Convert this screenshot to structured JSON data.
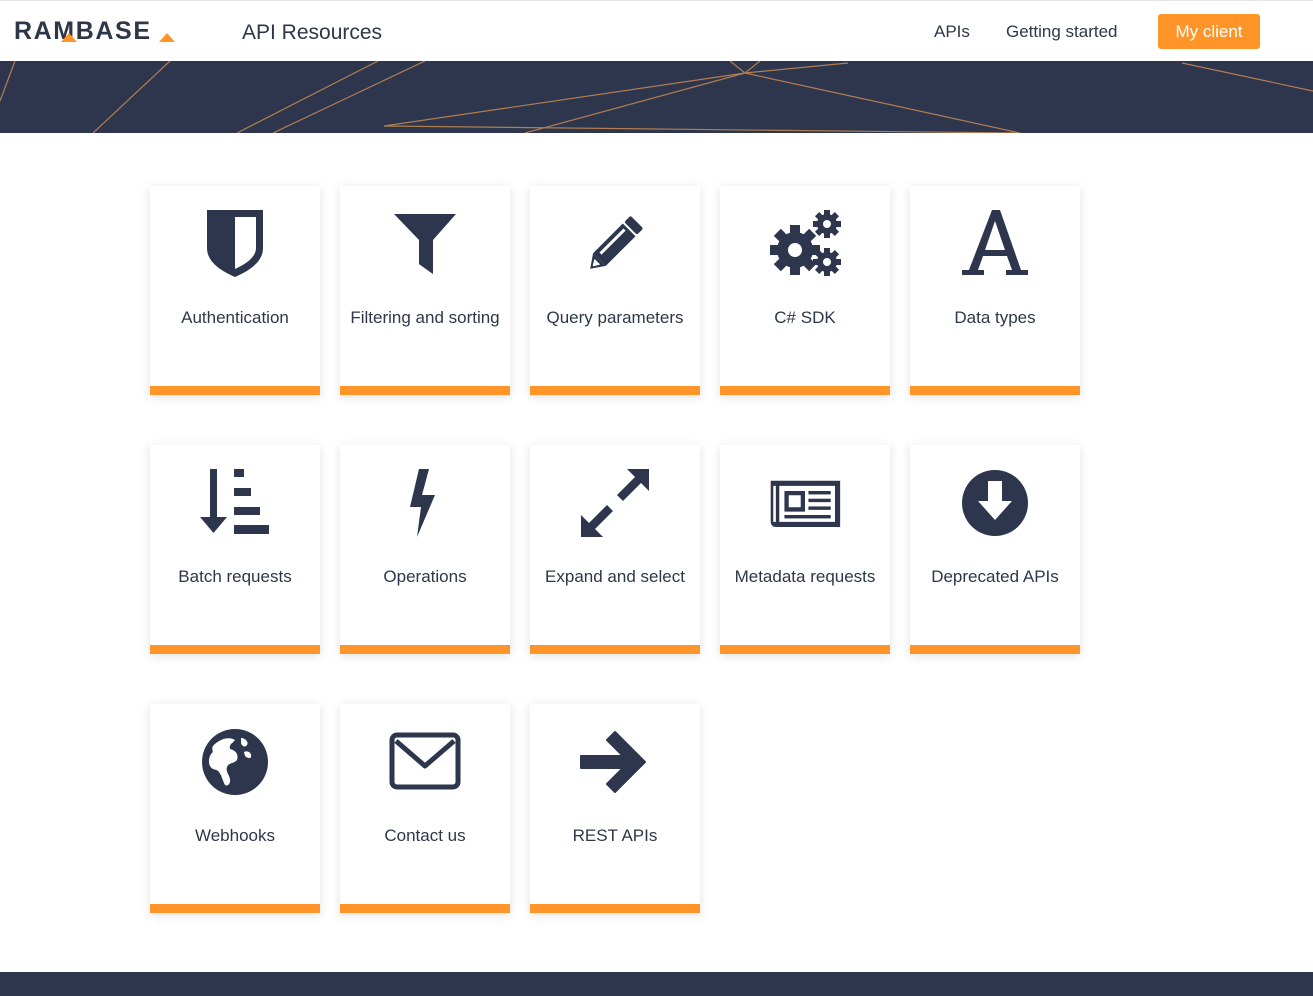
{
  "header": {
    "logo": "RAMBASE",
    "title": "API Resources",
    "nav": [
      {
        "label": "APIs"
      },
      {
        "label": "Getting started"
      }
    ],
    "cta_label": "My client"
  },
  "colors": {
    "accent": "#ff9428",
    "navy": "#2d364c",
    "text": "#2d3748"
  },
  "cards": [
    {
      "label": "Authentication",
      "icon": "shield-icon"
    },
    {
      "label": "Filtering and sorting",
      "icon": "filter-icon"
    },
    {
      "label": "Query parameters",
      "icon": "pencil-icon"
    },
    {
      "label": "C# SDK",
      "icon": "gears-icon"
    },
    {
      "label": "Data types",
      "icon": "font-icon"
    },
    {
      "label": "Batch requests",
      "icon": "sort-amount-desc-icon"
    },
    {
      "label": "Operations",
      "icon": "bolt-icon"
    },
    {
      "label": "Expand and select",
      "icon": "expand-arrows-icon"
    },
    {
      "label": "Metadata requests",
      "icon": "newspaper-icon"
    },
    {
      "label": "Deprecated APIs",
      "icon": "arrow-circle-down-icon"
    },
    {
      "label": "Webhooks",
      "icon": "globe-icon"
    },
    {
      "label": "Contact us",
      "icon": "envelope-icon"
    },
    {
      "label": "REST APIs",
      "icon": "arrow-right-icon"
    }
  ]
}
